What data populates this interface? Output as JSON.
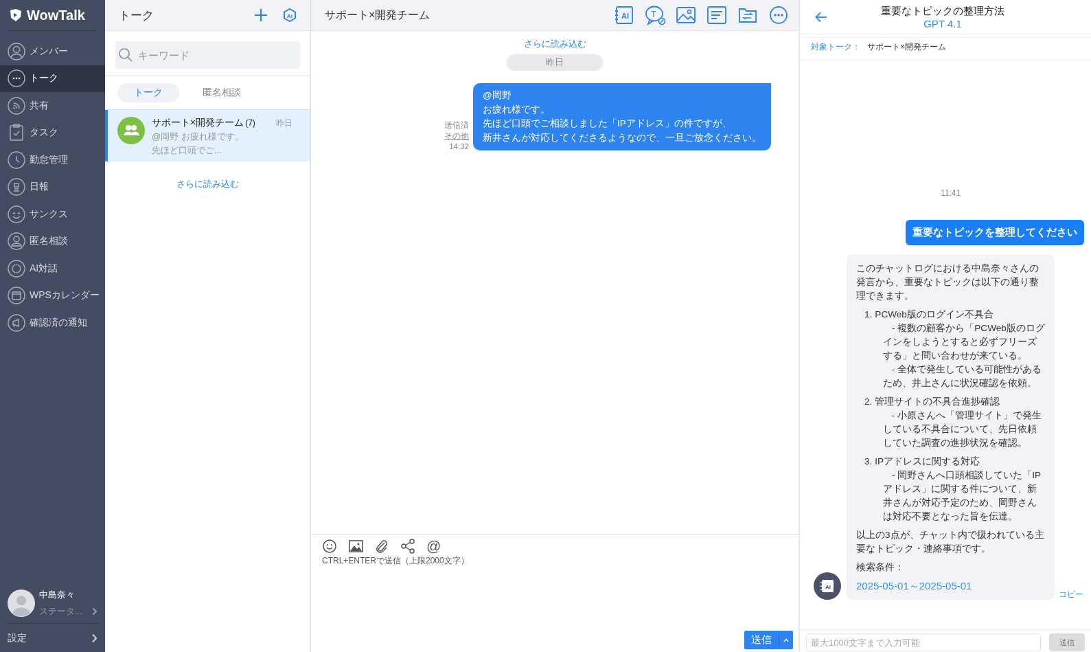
{
  "sidebar": {
    "logo": "WowTalk",
    "items": [
      {
        "label": "メンバー",
        "selected": false
      },
      {
        "label": "トーク",
        "selected": true
      },
      {
        "label": "共有",
        "selected": false
      },
      {
        "label": "タスク",
        "selected": false
      },
      {
        "label": "勤怠管理",
        "selected": false
      },
      {
        "label": "日報",
        "selected": false
      },
      {
        "label": "サンクス",
        "selected": false
      },
      {
        "label": "匿名相談",
        "selected": false
      },
      {
        "label": "AI対話",
        "selected": false
      },
      {
        "label": "WPSカレンダー",
        "selected": false
      },
      {
        "label": "確認済の通知",
        "selected": false
      }
    ],
    "user": {
      "name": "中島奈々",
      "status": "ステータ..."
    },
    "settings": "設定"
  },
  "talk_list": {
    "title": "トーク",
    "ai_badge": "AI",
    "search": {
      "placeholder": "キーワード"
    },
    "tabs": [
      {
        "label": "トーク",
        "selected": true
      },
      {
        "label": "匿名相談",
        "selected": false
      }
    ],
    "conversations": [
      {
        "name": "サポート×開発チーム",
        "count": "(7)",
        "time": "昨日",
        "preview": [
          "@岡野 お疲れ様です。",
          "先ほど口頭でご..."
        ],
        "selected": true
      }
    ],
    "load_more": "さらに読み込む"
  },
  "chat": {
    "title": "サポート×開発チーム",
    "tool_labels": {
      "ai": "AI",
      "text": "T"
    },
    "load_more": "さらに読み込む",
    "date": "昨日",
    "messages": [
      {
        "lines": [
          "@岡野",
          "お疲れ様です。",
          "先ほど口頭でご相談しました「IPアドレス」の件ですが、",
          "新井さんが対応してくださるようなので、一旦ご放念ください。"
        ],
        "status": "送信済",
        "other": "その他",
        "time": "14:32"
      }
    ],
    "composer": {
      "mention": "@",
      "hint": "CTRL+ENTERで送信（上限2000文字）",
      "send": "送信"
    }
  },
  "ai_panel": {
    "title": "重要なトピックの整理方法",
    "model": "GPT 4.1",
    "target_label": "対象トーク：",
    "target": "サポート×開発チーム",
    "time": "11:41",
    "user_message": "重要なトピックを整理してください",
    "answer": {
      "intro": "このチャットログにおける中島奈々さんの発言から、重要なトピックは以下の通り整理できます。",
      "items": [
        {
          "number": "1.",
          "title": "PCWeb版のログイン不具合",
          "details": [
            "- 複数の顧客から「PCWeb版のログインをしようとすると必ずフリーズする」と問い合わせが来ている。",
            "- 全体で発生している可能性があるため、井上さんに状況確認を依頼。"
          ]
        },
        {
          "number": "2.",
          "title": "管理サイトの不具合進捗確認",
          "details": [
            "- 小原さんへ「管理サイト」で発生している不具合について、先日依頼していた調査の進捗状況を確認。"
          ]
        },
        {
          "number": "3.",
          "title": "IPアドレスに関する対応",
          "details": [
            "- 岡野さんへ口頭相談していた「IPアドレス」に関する件について、新井さんが対応予定のため、岡野さんは対応不要となった旨を伝達。"
          ]
        }
      ],
      "summary": "以上の3点が、チャット内で扱われている主要なトピック・連絡事項です。",
      "search_label": "検索条件：",
      "search_range": "2025-05-01～2025-05-01"
    },
    "avatar_label": "AI",
    "copy": "コピー",
    "input": {
      "placeholder": "最大1000文字まで入力可能"
    },
    "send": {
      "label": "送信",
      "disabled": true
    }
  }
}
